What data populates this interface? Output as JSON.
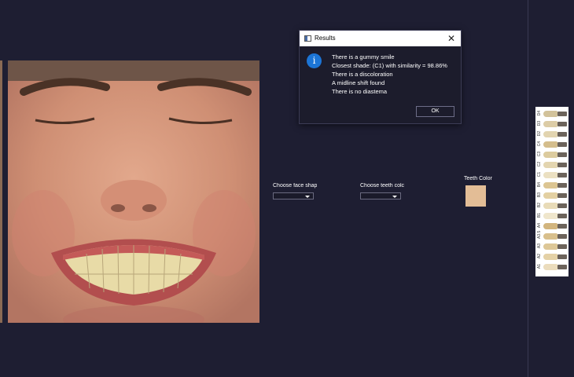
{
  "dialog": {
    "title": "Results",
    "close_glyph": "✕",
    "icon": "info-icon",
    "icon_glyph": "i",
    "messages": [
      "There is a gummy smile",
      "Closest shade: (C1) with similarity = 98.86%",
      "There is a discoloration",
      "A midline shift found",
      "There is no diastema"
    ],
    "ok_label": "OK"
  },
  "controls": {
    "face_shape_label": "Choose face shap",
    "teeth_color_label": "Choose teeth colc",
    "teeth_color_title": "Teeth Color",
    "teeth_color_hex": "#e3bd96"
  },
  "shade_guide": {
    "codes": [
      "D4",
      "D3",
      "D2",
      "C4",
      "C3",
      "C2",
      "C1",
      "B4",
      "B3",
      "B2",
      "B1",
      "A4",
      "A3.5",
      "A3",
      "A2",
      "A1"
    ]
  },
  "colors": {
    "background": "#1e1e32",
    "info_blue": "#1c75d6"
  }
}
